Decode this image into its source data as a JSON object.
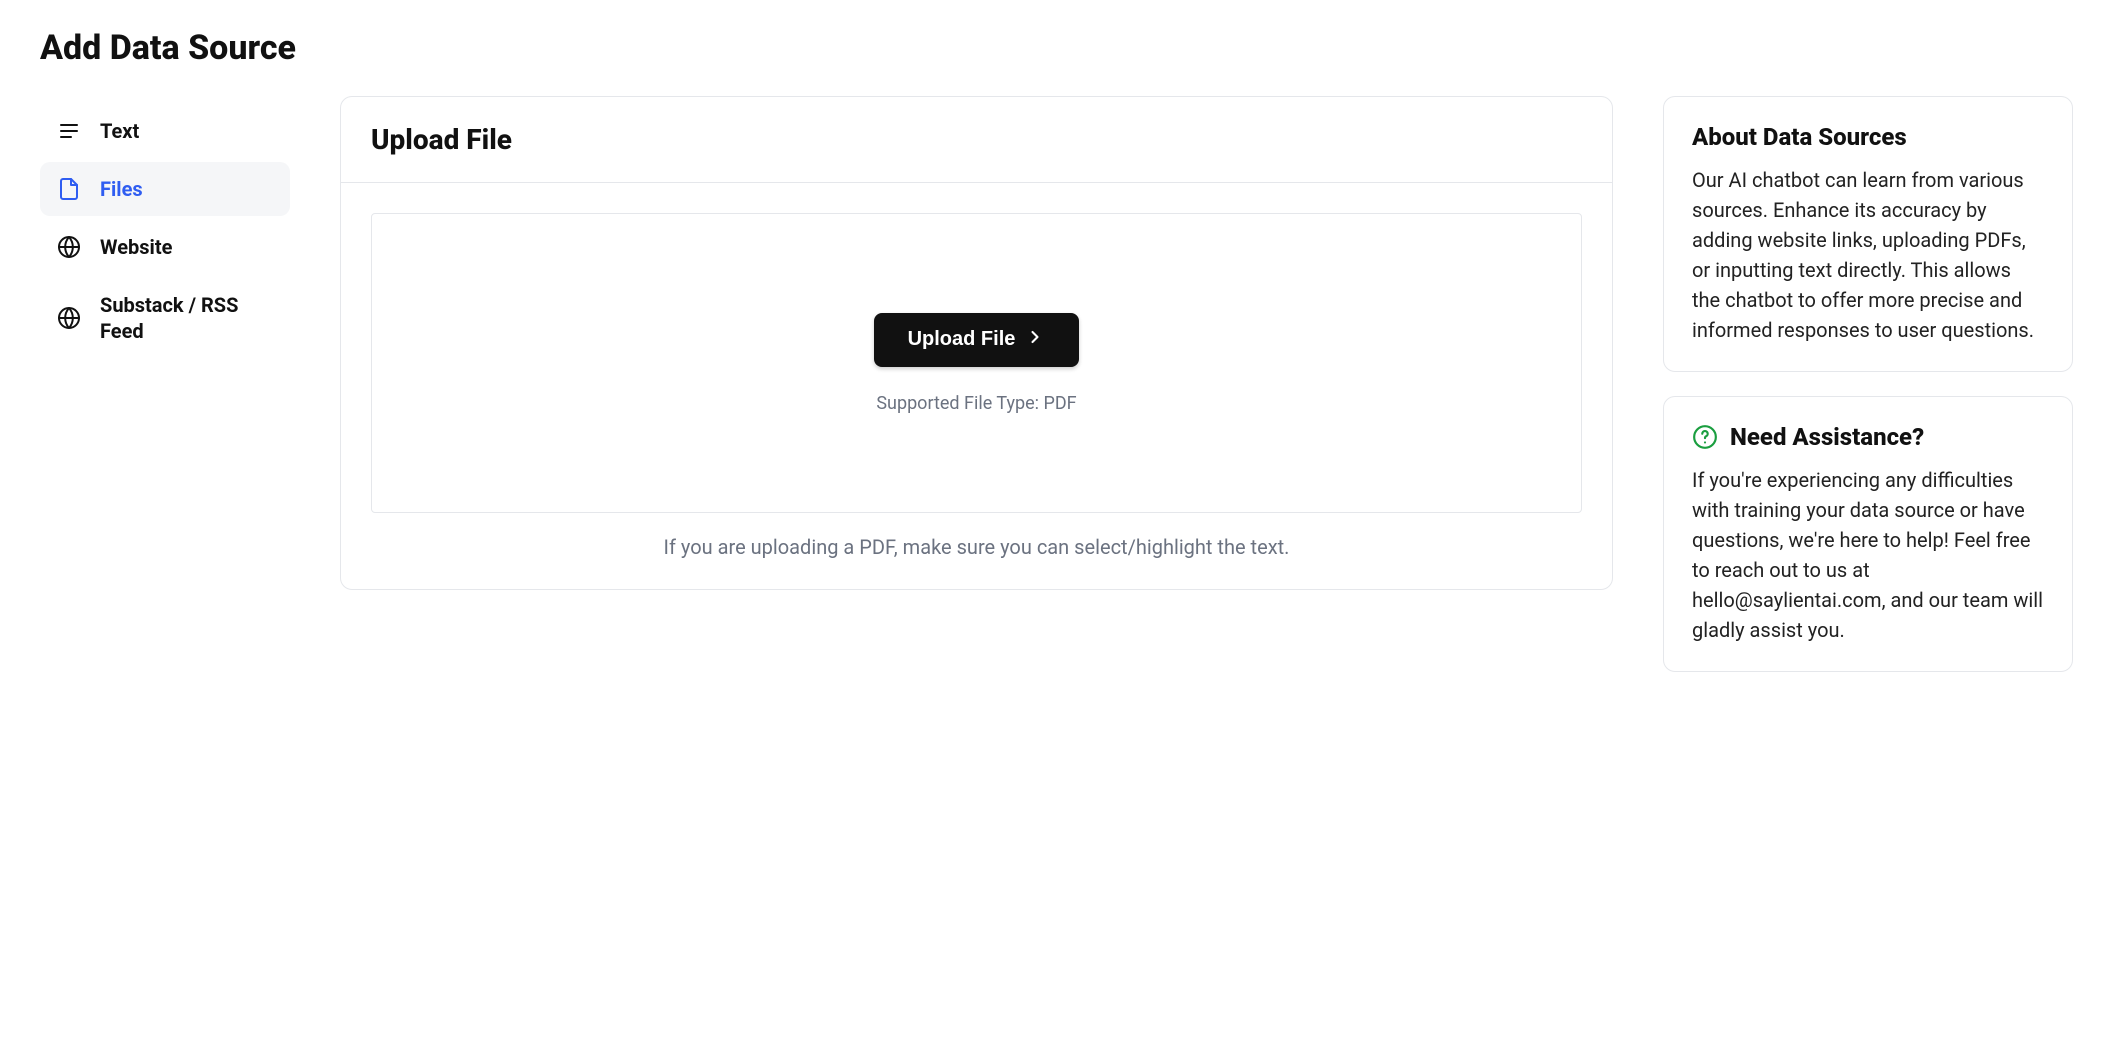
{
  "page": {
    "title": "Add Data Source"
  },
  "sidebar": {
    "items": [
      {
        "label": "Text"
      },
      {
        "label": "Files"
      },
      {
        "label": "Website"
      },
      {
        "label": "Substack / RSS Feed"
      }
    ],
    "active_index": 1
  },
  "main": {
    "heading": "Upload File",
    "upload_button_label": "Upload File",
    "supported_text": "Supported File Type: PDF",
    "hint_text": "If you are uploading a PDF, make sure you can select/highlight the text."
  },
  "info": {
    "about": {
      "title": "About Data Sources",
      "body": "Our AI chatbot can learn from various sources. Enhance its accuracy by adding website links, uploading PDFs, or inputting text directly. This allows the chatbot to offer more precise and informed responses to user questions."
    },
    "assistance": {
      "title": "Need Assistance?",
      "body": "If you're experiencing any difficulties with training your data source or have questions, we're here to help! Feel free to reach out to us at hello@saylientai.com, and our team will gladly assist you."
    }
  }
}
